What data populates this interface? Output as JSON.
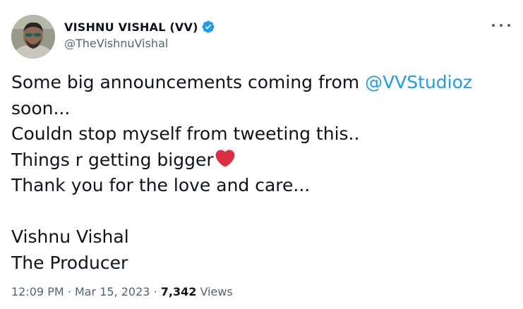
{
  "author": {
    "display_name": "VISHNU VISHAL (VV)",
    "handle": "@TheVishnuVishal",
    "verified": true,
    "avatar": "profile-photo"
  },
  "tweet": {
    "line1_text": "Some big announcements coming from ",
    "line1_mention": "@VVStudioz",
    "line2": "soon...",
    "line3": "Couldn stop myself from tweeting this..",
    "line4": "Things r getting bigger",
    "line4_emoji": "red-heart",
    "line5": "Thank you for the love and care...",
    "line7": "Vishnu Vishal",
    "line8": "The Producer"
  },
  "meta": {
    "time": "12:09 PM",
    "separator": "·",
    "date": "Mar 15, 2023",
    "views_count": "7,342",
    "views_label": "Views"
  },
  "icons": {
    "more": "more-horizontal-icon",
    "verified": "verified-badge-icon"
  },
  "colors": {
    "text": "#0f1419",
    "secondary": "#536471",
    "link": "#1d9bf0",
    "verified": "#1d9bf0",
    "heart": "#dd2e44"
  }
}
